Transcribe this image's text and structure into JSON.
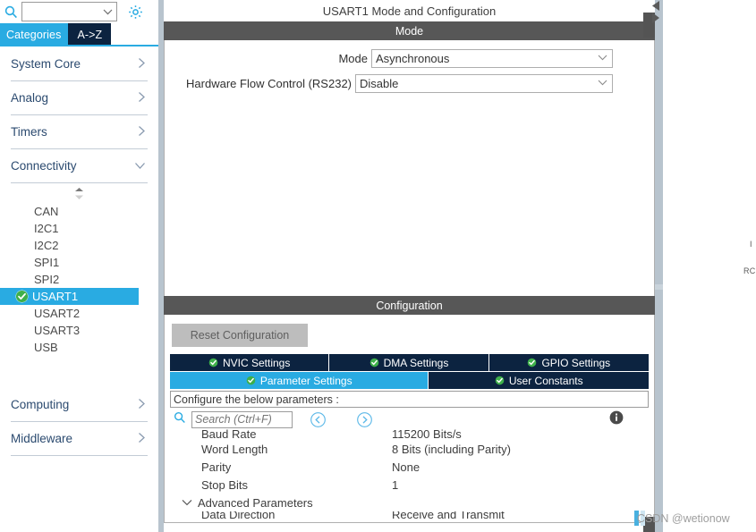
{
  "sidebar": {
    "search": {
      "icon": "search-icon",
      "value": "",
      "placeholder": ""
    },
    "gear_icon": "gear-icon",
    "tabs": [
      {
        "label": "Categories",
        "active": true
      },
      {
        "label": "A->Z",
        "active": false
      }
    ],
    "categories": [
      {
        "label": "System Core",
        "expanded": false,
        "chevron": "chevron-right-icon"
      },
      {
        "label": "Analog",
        "expanded": false,
        "chevron": "chevron-right-icon"
      },
      {
        "label": "Timers",
        "expanded": false,
        "chevron": "chevron-right-icon"
      },
      {
        "label": "Connectivity",
        "expanded": true,
        "chevron": "chevron-down-icon"
      }
    ],
    "connectivity_items": [
      {
        "label": "CAN",
        "selected": false,
        "configured": false
      },
      {
        "label": "I2C1",
        "selected": false,
        "configured": false
      },
      {
        "label": "I2C2",
        "selected": false,
        "configured": false
      },
      {
        "label": "SPI1",
        "selected": false,
        "configured": false
      },
      {
        "label": "SPI2",
        "selected": false,
        "configured": false
      },
      {
        "label": "USART1",
        "selected": true,
        "configured": true
      },
      {
        "label": "USART2",
        "selected": false,
        "configured": false
      },
      {
        "label": "USART3",
        "selected": false,
        "configured": false
      },
      {
        "label": "USB",
        "selected": false,
        "configured": false
      }
    ],
    "categories_bottom": [
      {
        "label": "Computing",
        "expanded": false,
        "chevron": "chevron-right-icon"
      },
      {
        "label": "Middleware",
        "expanded": false,
        "chevron": "chevron-right-icon"
      }
    ]
  },
  "main": {
    "panel_title": "USART1 Mode and Configuration",
    "mode_band": "Mode",
    "mode_fields": [
      {
        "label": "Mode",
        "value": "Asynchronous"
      },
      {
        "label": "Hardware Flow Control (RS232)",
        "value": "Disable"
      }
    ],
    "config_band": "Configuration",
    "reset_button": "Reset Configuration",
    "tabs_row1": [
      {
        "label": "NVIC Settings",
        "active": false,
        "check": "check-circle-icon"
      },
      {
        "label": "DMA Settings",
        "active": false,
        "check": "check-circle-icon"
      },
      {
        "label": "GPIO Settings",
        "active": false,
        "check": "check-circle-icon"
      }
    ],
    "tabs_row2": [
      {
        "label": "Parameter Settings",
        "active": true,
        "check": "check-circle-icon"
      },
      {
        "label": "User Constants",
        "active": false,
        "check": "check-circle-icon"
      }
    ],
    "hint": "Configure the below parameters :",
    "param_search": {
      "icon": "search-icon",
      "value": "",
      "placeholder": "Search (Ctrl+F)",
      "prev_icon": "nav-prev-icon",
      "next_icon": "nav-next-icon",
      "info_icon": "info-icon"
    },
    "parameters": [
      {
        "name": "Baud Rate",
        "value": "115200 Bits/s",
        "type": "row",
        "clipped": "top"
      },
      {
        "name": "Word Length",
        "value": "8 Bits (including Parity)",
        "type": "row"
      },
      {
        "name": "Parity",
        "value": "None",
        "type": "row"
      },
      {
        "name": "Stop Bits",
        "value": "1",
        "type": "row"
      },
      {
        "name": "Advanced Parameters",
        "value": "",
        "type": "group",
        "chevron": "chevron-down-icon"
      },
      {
        "name": "Data Direction",
        "value": "Receive and Transmit",
        "type": "row",
        "clipped": "bottom"
      }
    ],
    "scrollbar": {
      "name": "parameter-scrollbar",
      "position": 22
    }
  },
  "right_panel": {
    "fragment_1": "I",
    "fragment_2": "RC"
  },
  "watermark": {
    "text": "CSDN @wetionow"
  },
  "colors": {
    "accent_blue": "#29abe2",
    "tab_navy": "#0c2340",
    "band_gray": "#575757",
    "splitter": "#b8c4ce",
    "check_green": "#4caf50",
    "sidebar_text": "#2b4a6f"
  }
}
